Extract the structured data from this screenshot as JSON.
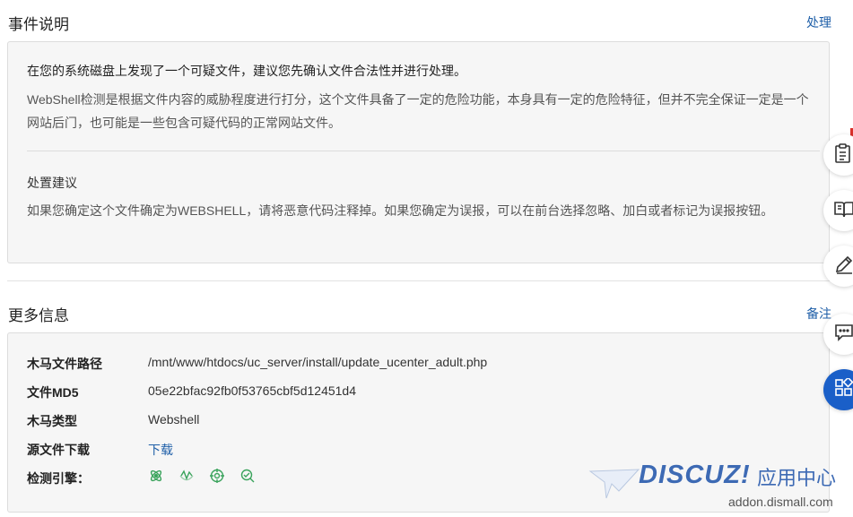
{
  "event": {
    "title": "事件说明",
    "action_label": "处理",
    "summary": "在您的系统磁盘上发现了一个可疑文件，建议您先确认文件合法性并进行处理。",
    "detail": "WebShell检测是根据文件内容的威胁程度进行打分，这个文件具备了一定的危险功能，本身具有一定的危险特征，但并不完全保证一定是一个网站后门，也可能是一些包含可疑代码的正常网站文件。",
    "advice_title": "处置建议",
    "advice_text": "如果您确定这个文件确定为WEBSHELL，请将恶意代码注释掉。如果您确定为误报，可以在前台选择忽略、加白或者标记为误报按钮。"
  },
  "more": {
    "title": "更多信息",
    "action_label": "备注",
    "fields": {
      "path_label": "木马文件路径",
      "path_value": "/mnt/www/htdocs/uc_server/install/update_ucenter_adult.php",
      "md5_label": "文件MD5",
      "md5_value": "05e22bfac92fb0f53765cbf5d12451d4",
      "type_label": "木马类型",
      "type_value": "Webshell",
      "download_label": "源文件下载",
      "download_value": "下载",
      "engine_label": "检测引擎："
    },
    "engine_icons": [
      "engine-atom-icon",
      "engine-wave-icon",
      "engine-crosshair-icon",
      "engine-scan-icon"
    ]
  },
  "watermark": {
    "logo": "DISCUZ!",
    "cn": "应用中心",
    "url": "addon.dismall.com"
  },
  "colors": {
    "link": "#1f5fa8",
    "card_bg": "#f6f6f6",
    "engine_green": "#3aa35c",
    "float_active": "#1a5fc8"
  }
}
